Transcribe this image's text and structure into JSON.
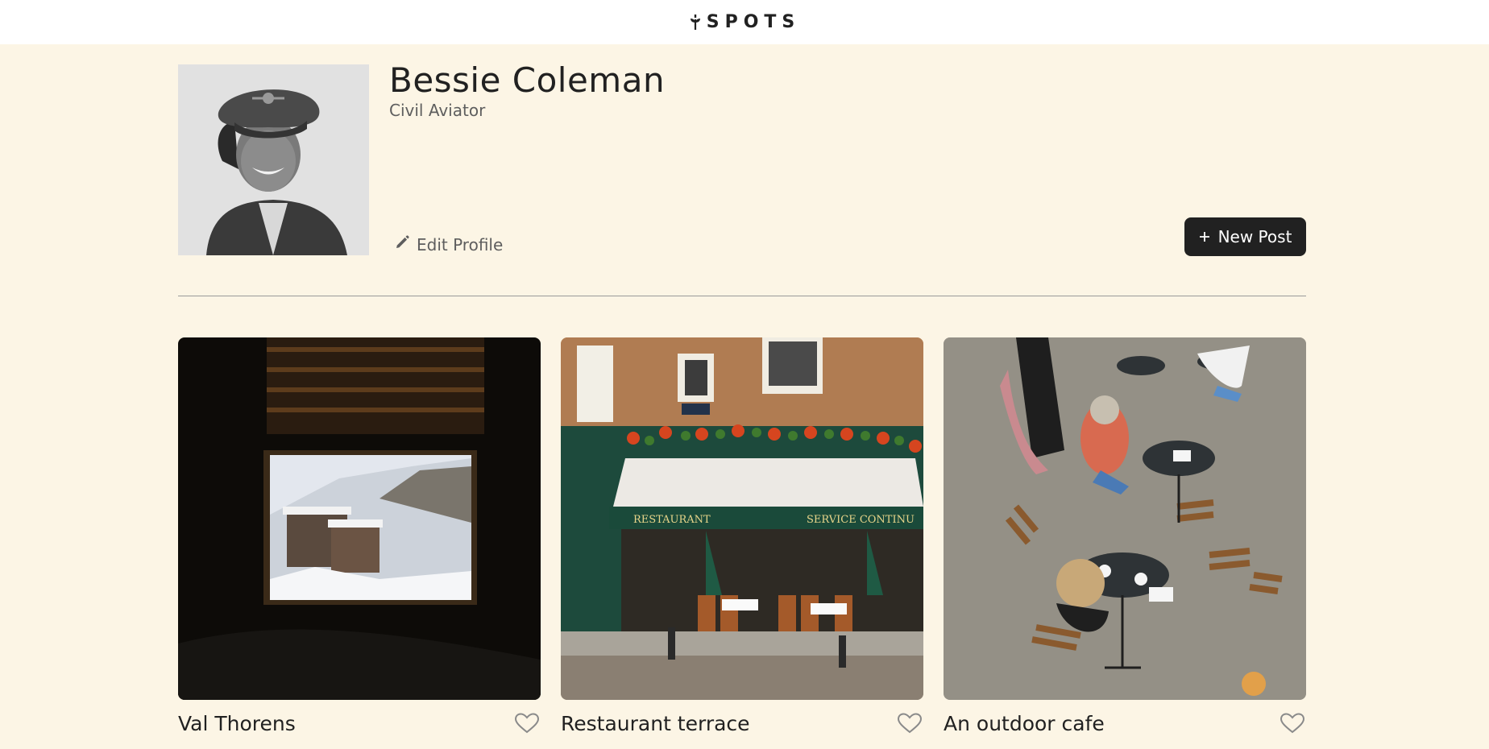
{
  "header": {
    "logo_text": "SPOTS",
    "logo_icon": "sprout-icon"
  },
  "profile": {
    "name": "Bessie Coleman",
    "description": "Civil Aviator",
    "avatar_icon": "avatar-photo",
    "edit_label": "Edit Profile",
    "edit_icon": "pencil-icon",
    "new_post_label": "New Post",
    "new_post_icon": "plus-icon"
  },
  "cards": [
    {
      "title": "Val Thorens",
      "image": "snowy-mountain-window-photo",
      "liked": false
    },
    {
      "title": "Restaurant terrace",
      "image": "restaurant-storefront-photo",
      "liked": false
    },
    {
      "title": "An outdoor cafe",
      "image": "outdoor-cafe-tables-photo",
      "liked": false
    }
  ],
  "colors": {
    "background": "#FCF5E5",
    "header_background": "#FFFFFF",
    "text": "#212121",
    "muted_text": "#5E5E5E",
    "button_background": "#212121",
    "divider": "#9A9A9A"
  }
}
